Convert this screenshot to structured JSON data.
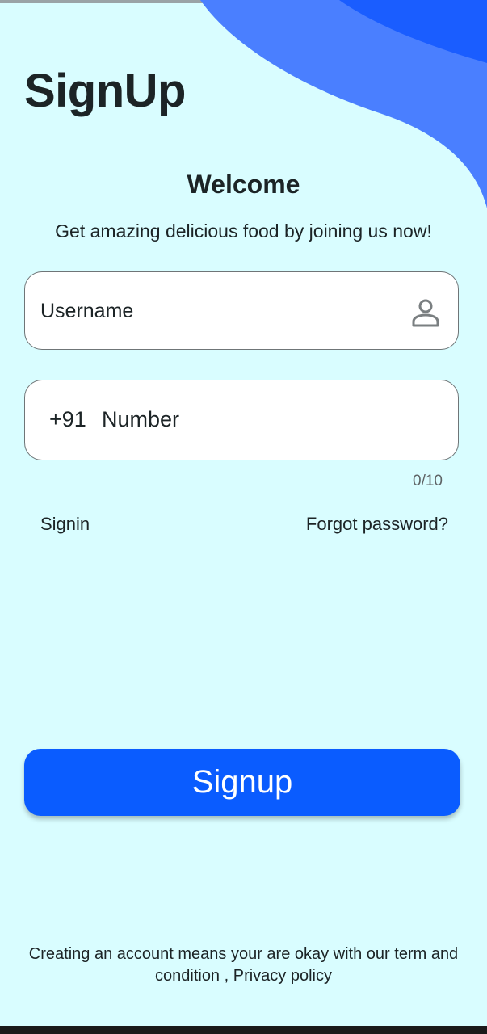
{
  "header": {
    "title": "SignUp"
  },
  "intro": {
    "welcome": "Welcome",
    "subtitle": "Get amazing delicious food by joining us now!"
  },
  "form": {
    "username": {
      "label": "Username",
      "icon": "person-icon"
    },
    "phone": {
      "prefix": "+91",
      "placeholder": "Number",
      "counter": "0/10"
    }
  },
  "links": {
    "signin": "Signin",
    "forgot": "Forgot password?"
  },
  "actions": {
    "signup_label": "Signup"
  },
  "footer": {
    "terms_line1": "Creating an account means your are okay with our term and",
    "terms_line2": "condition , Privacy policy"
  },
  "colors": {
    "background": "#d9fdff",
    "wave_light": "#4a7fff",
    "wave_dark": "#1a5dff",
    "button": "#0a5cff"
  }
}
